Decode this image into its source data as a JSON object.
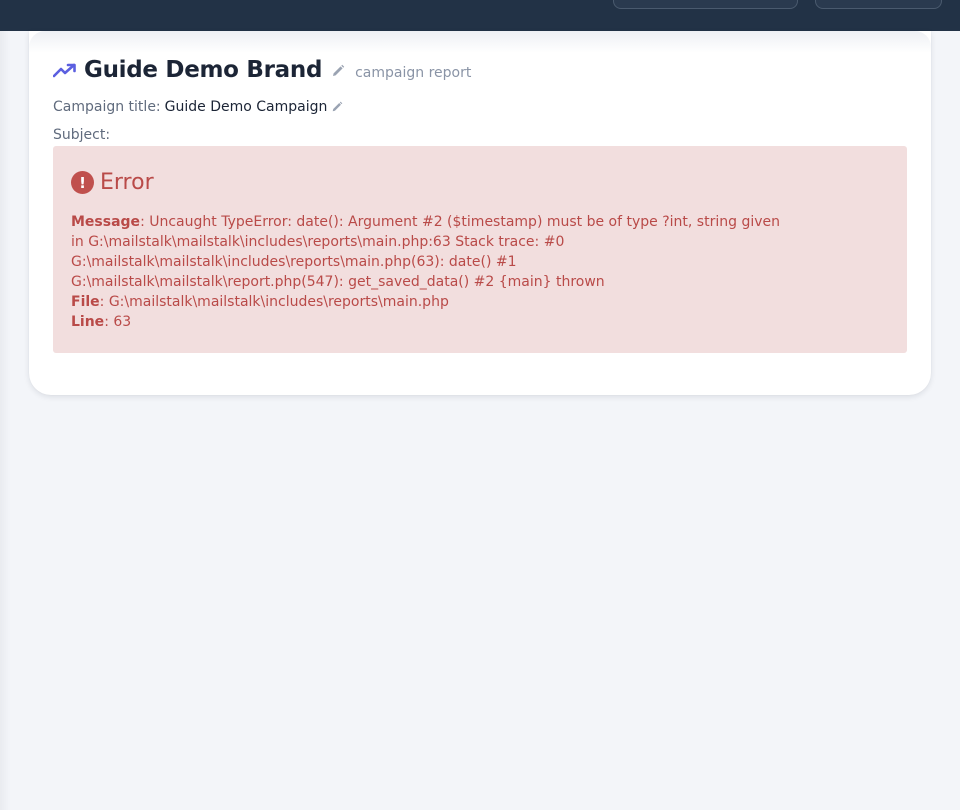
{
  "header": {
    "brand_title": "Guide Demo Brand",
    "report_label": "campaign report"
  },
  "campaign": {
    "title_label": "Campaign title:",
    "title_value": "Guide Demo Campaign",
    "subject_label": "Subject:",
    "subject_value": ""
  },
  "error": {
    "title": "Error",
    "icon_glyph": "!",
    "message_label": "Message",
    "message_text": ": Uncaught TypeError: date(): Argument #2 ($timestamp) must be of type ?int, string given in G:\\mailstalk\\mailstalk\\includes\\reports\\main.php:63 Stack trace: #0 G:\\mailstalk\\mailstalk\\includes\\reports\\main.php(63): date() #1 G:\\mailstalk\\mailstalk\\report.php(547): get_saved_data() #2 {main} thrown",
    "file_label": "File",
    "file_text": ": G:\\mailstalk\\mailstalk\\includes\\reports\\main.php",
    "line_label": "Line",
    "line_text": ": 63"
  },
  "colors": {
    "topbar": "#223246",
    "accent_icon": "#5b5fe0",
    "error_bg": "#f2dede",
    "error_text": "#b94a48"
  },
  "icons": {
    "trend": "trending-up-icon",
    "edit": "pencil-icon",
    "error": "exclamation-circle-icon"
  }
}
